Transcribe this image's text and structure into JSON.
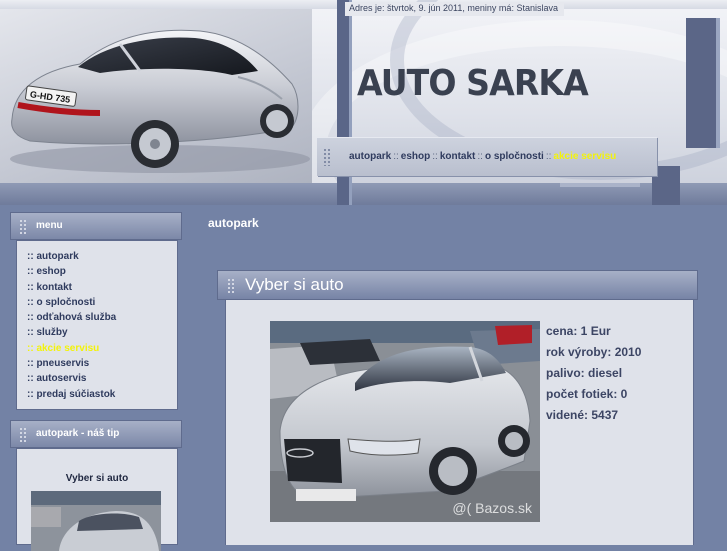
{
  "header": {
    "date_text": "Adres je: štvrtok, 9. jún 2011,",
    "nameday_label": "meniny má:",
    "nameday_name": "Stanislava",
    "logo": "AUTO SARKA",
    "car_plate": "G-HD 735"
  },
  "topnav": {
    "items": [
      {
        "label": "autopark"
      },
      {
        "label": "eshop"
      },
      {
        "label": "kontakt"
      },
      {
        "label": "o spločnosti"
      },
      {
        "label": "akcie servisu"
      }
    ],
    "separator": "::",
    "highlight_color": "#f3f30a"
  },
  "sidebar": {
    "menu_title": "menu",
    "menu_items": [
      {
        "label": ":: autopark"
      },
      {
        "label": ":: eshop"
      },
      {
        "label": ":: kontakt"
      },
      {
        "label": ":: o spločnosti"
      },
      {
        "label": ":: odťahová služba"
      },
      {
        "label": ":: služby"
      },
      {
        "label": ":: akcie servisu"
      },
      {
        "label": ":: pneuservis"
      },
      {
        "label": ":: autoservis"
      },
      {
        "label": ":: predaj súčiastok"
      }
    ],
    "tip_title": "autopark - náš tip",
    "tip_car_title": "Vyber si auto"
  },
  "main": {
    "heading": "autopark",
    "card_title": "Vyber si auto",
    "specs": {
      "price": "cena: 1 Eur",
      "year": "rok výroby: 2010",
      "fuel": "palivo: diesel",
      "photos": "počet fotiek: 0",
      "views": "videné: 5437"
    },
    "watermark": "@( Bazos.sk"
  },
  "colors": {
    "background": "#7382a5",
    "link": "#2f3b5e",
    "highlight": "#f3f30a",
    "panel": "#dfe2ea"
  }
}
